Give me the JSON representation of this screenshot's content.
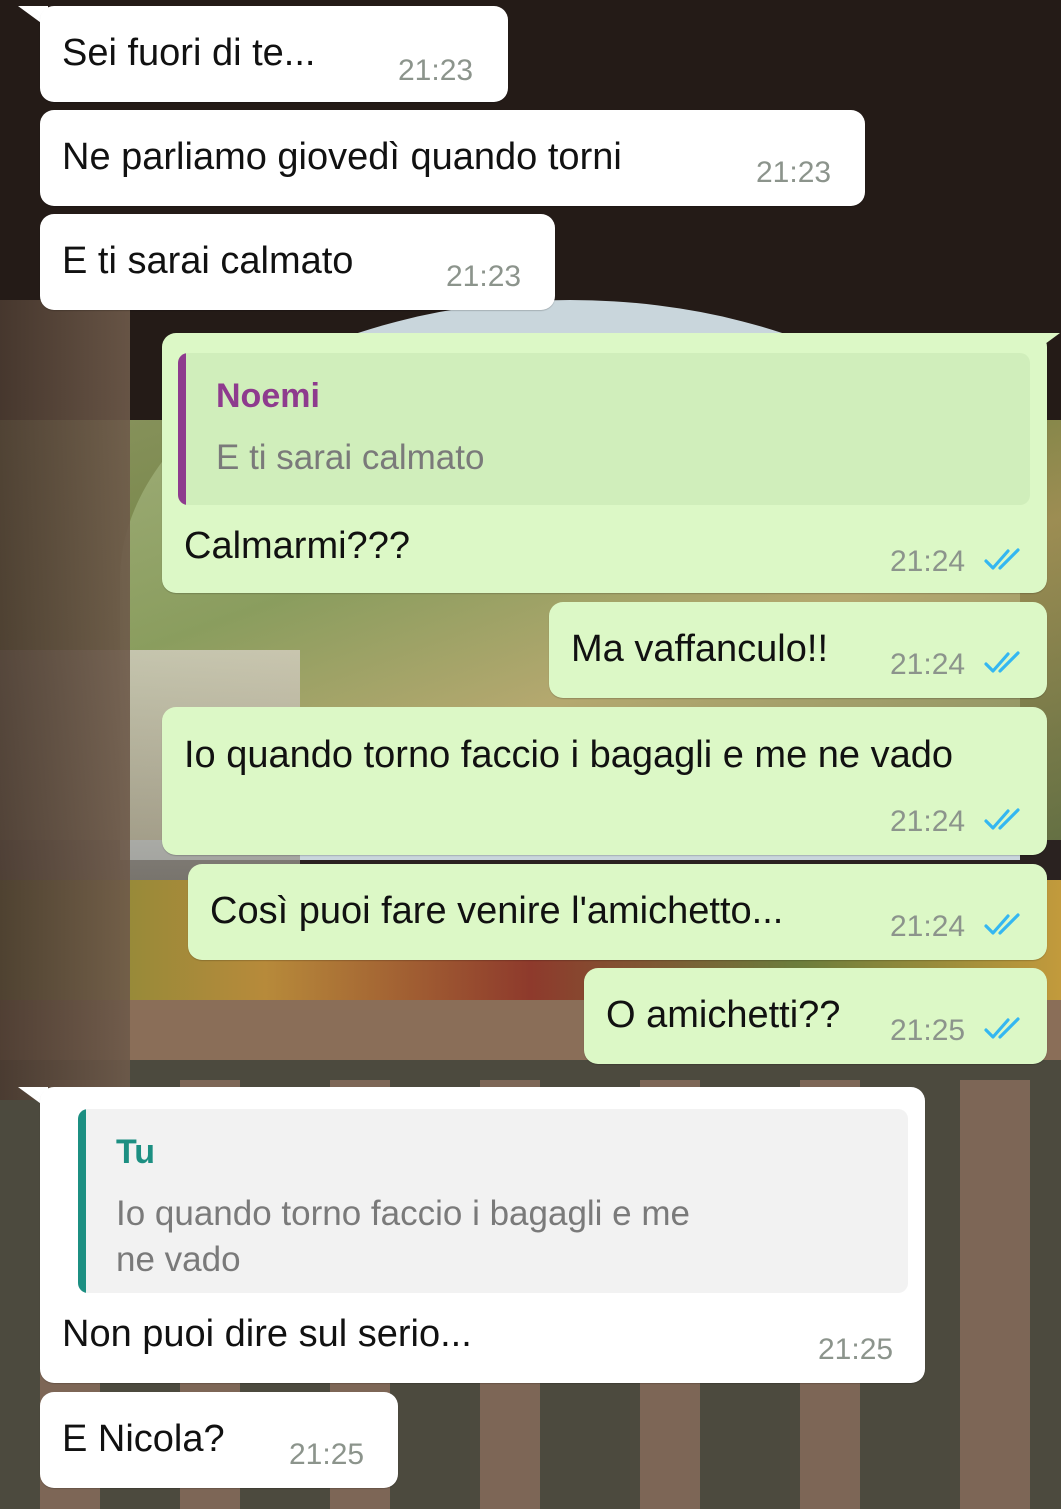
{
  "theme": {
    "incoming_bg": "#ffffff",
    "outgoing_bg": "#dcf8c6",
    "quote_out_bg": "#d0eebb",
    "quote_in_bg": "#f2f2f2",
    "quote_author_noemi": "#8e3b8e",
    "quote_author_tu": "#1c8f82",
    "read_ticks": "#34b7f1",
    "time_color": "#8c948c"
  },
  "messages": [
    {
      "text": "Sei fuori di te...",
      "time": "21:23"
    },
    {
      "text": "Ne parliamo giovedì quando torni",
      "time": "21:23"
    },
    {
      "text": "E ti sarai calmato",
      "time": "21:23"
    },
    {
      "quote_author": "Noemi",
      "quote_text": "E ti sarai calmato",
      "text": "Calmarmi???",
      "time": "21:24",
      "status_icon": "double-check-read-icon"
    },
    {
      "text": "Ma vaffanculo!!",
      "time": "21:24",
      "status_icon": "double-check-read-icon"
    },
    {
      "text": "Io quando torno faccio i bagagli e me ne vado",
      "time": "21:24",
      "status_icon": "double-check-read-icon"
    },
    {
      "text": "Così puoi fare venire l'amichetto...",
      "time": "21:24",
      "status_icon": "double-check-read-icon"
    },
    {
      "text": "O amichetti??",
      "time": "21:25",
      "status_icon": "double-check-read-icon"
    },
    {
      "quote_author": "Tu",
      "quote_text": "Io quando torno faccio i bagagli e me ne vado",
      "text": "Non puoi dire sul serio...",
      "time": "21:25"
    },
    {
      "text": "E Nicola?",
      "time": "21:25"
    }
  ]
}
